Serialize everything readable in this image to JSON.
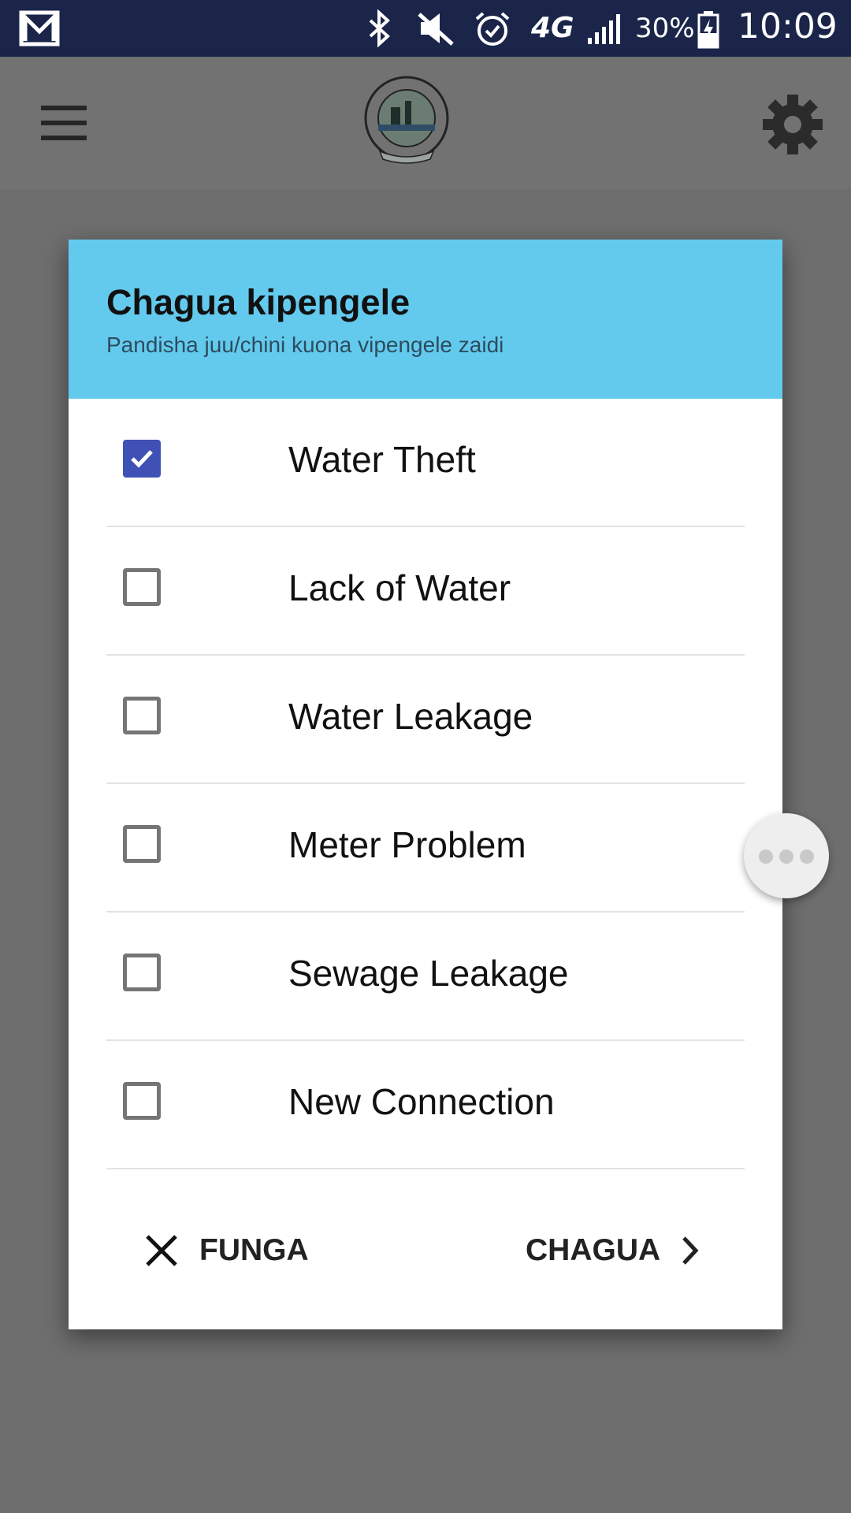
{
  "status_bar": {
    "battery": "30%",
    "time": "10:09",
    "network": "4G",
    "icons": [
      "gmail-icon",
      "bluetooth-icon",
      "mute-icon",
      "alarm-icon",
      "signal-icon",
      "battery-charging-icon"
    ]
  },
  "app_bar": {
    "menu_icon": "hamburger-menu-icon",
    "logo": "water-authority-logo",
    "settings_icon": "gear-icon"
  },
  "dialog": {
    "title": "Chagua kipengele",
    "subtitle": "Pandisha juu/chini kuona vipengele zaidi",
    "options": [
      {
        "label": "Water Theft",
        "checked": true
      },
      {
        "label": "Lack of Water",
        "checked": false
      },
      {
        "label": "Water Leakage",
        "checked": false
      },
      {
        "label": "Meter Problem",
        "checked": false
      },
      {
        "label": "Sewage Leakage",
        "checked": false
      },
      {
        "label": "New Connection",
        "checked": false
      }
    ],
    "close_label": "FUNGA",
    "choose_label": "CHAGUA"
  },
  "colors": {
    "status_bar": "#1a2549",
    "dialog_header": "#63caee",
    "checkbox_checked": "#3f51b5"
  }
}
